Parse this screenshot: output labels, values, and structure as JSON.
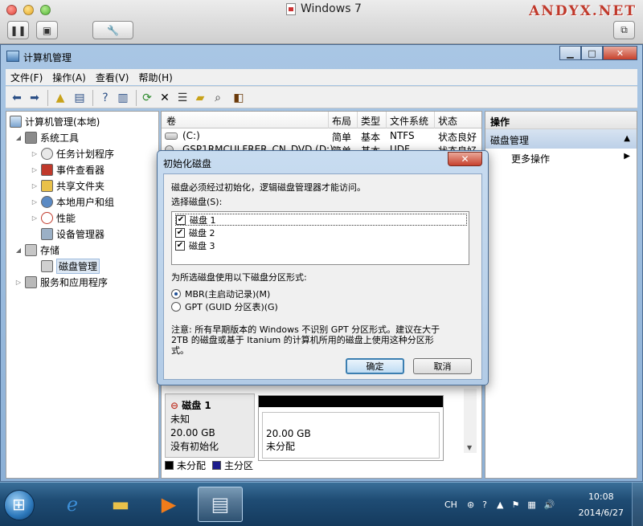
{
  "host": {
    "title": "Windows 7",
    "brand": "ANDYX.NET"
  },
  "window": {
    "title": "计算机管理",
    "menu": [
      "文件(F)",
      "操作(A)",
      "查看(V)",
      "帮助(H)"
    ]
  },
  "tree": {
    "root": "计算机管理(本地)",
    "items": [
      "系统工具",
      "任务计划程序",
      "事件查看器",
      "共享文件夹",
      "本地用户和组",
      "性能",
      "设备管理器",
      "存储",
      "磁盘管理",
      "服务和应用程序"
    ]
  },
  "table": {
    "columns": [
      "卷",
      "布局",
      "类型",
      "文件系统",
      "状态"
    ],
    "rows": [
      {
        "vol": "(C:)",
        "layout": "简单",
        "type": "基本",
        "fs": "NTFS",
        "status": "状态良好"
      },
      {
        "vol": "GSP1RMCULFRER_CN_DVD (D:)",
        "layout": "简单",
        "type": "基本",
        "fs": "UDF",
        "status": "状态良好"
      }
    ]
  },
  "disk_panel": {
    "name": "磁盘 1",
    "kind": "未知",
    "size": "20.00 GB",
    "state": "没有初始化",
    "vol_size": "20.00 GB",
    "vol_state": "未分配",
    "legend": [
      {
        "label": "未分配",
        "color": "#000000"
      },
      {
        "label": "主分区",
        "color": "#1c1c8c"
      }
    ]
  },
  "actions": {
    "header": "操作",
    "group": "磁盘管理",
    "more": "更多操作"
  },
  "dialog": {
    "title": "初始化磁盘",
    "close": "✕",
    "intro": "磁盘必须经过初始化，逻辑磁盘管理器才能访问。",
    "select_label": "选择磁盘(S):",
    "disks": [
      {
        "label": "磁盘 1",
        "checked": true
      },
      {
        "label": "磁盘 2",
        "checked": true
      },
      {
        "label": "磁盘 3",
        "checked": true
      }
    ],
    "partition_label": "为所选磁盘使用以下磁盘分区形式:",
    "mbr": "MBR(主启动记录)(M)",
    "gpt": "GPT (GUID 分区表)(G)",
    "note_line1": "注意: 所有早期版本的 Windows 不识别 GPT 分区形式。建议在大于",
    "note_line2": "2TB 的磁盘或基于 Itanium 的计算机所用的磁盘上使用这种分区形",
    "note_line3": "式。",
    "ok": "确定",
    "cancel": "取消"
  },
  "taskbar": {
    "lang": "CH",
    "time": "10:08",
    "date": "2014/6/27"
  }
}
